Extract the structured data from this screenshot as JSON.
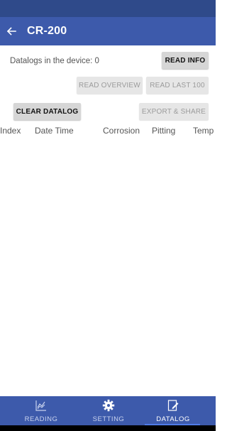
{
  "app_bar": {
    "back_icon": "arrow-back-icon",
    "title": "CR-200"
  },
  "device": {
    "datalog_count_text": "Datalogs in the device: 0"
  },
  "buttons": {
    "read_info": "READ INFO",
    "read_overview": "READ OVERVIEW",
    "read_last_100": "READ LAST 100",
    "clear_datalog": "CLEAR DATALOG",
    "export_share": "EXPORT & SHARE"
  },
  "table": {
    "columns": [
      "Index",
      "Date Time",
      "Corrosion",
      "Pitting",
      "Temp"
    ],
    "rows": []
  },
  "bottom_nav": {
    "items": [
      {
        "label": "READING",
        "icon": "chart-icon",
        "active": false
      },
      {
        "label": "SETTING",
        "icon": "gear-icon",
        "active": false
      },
      {
        "label": "DATALOG",
        "icon": "edit-note-icon",
        "active": true
      }
    ]
  },
  "colors": {
    "primary": "#3d5aab",
    "status_bar": "#2f4a8a",
    "accent": "#4f7be8"
  }
}
